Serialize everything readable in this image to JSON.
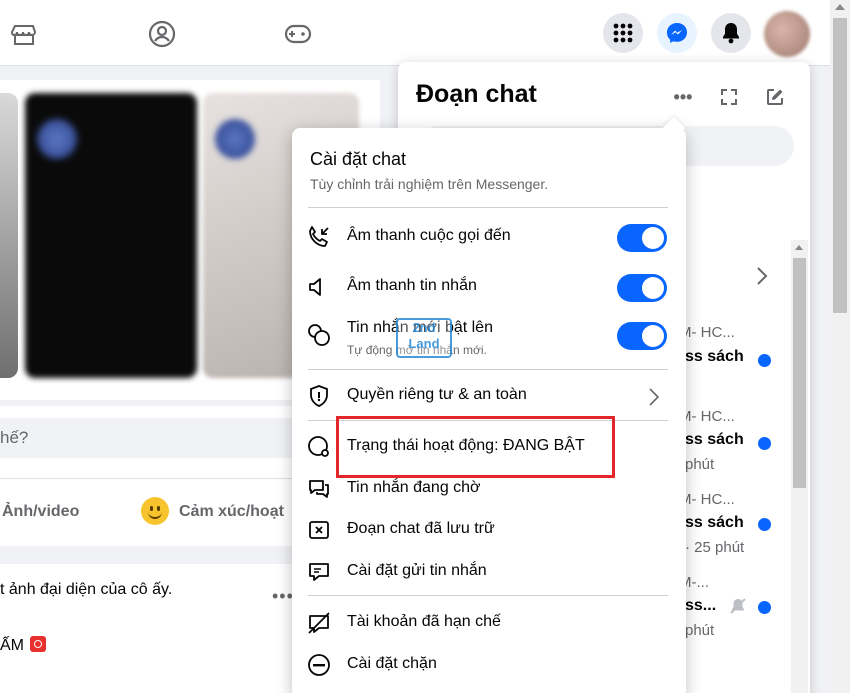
{
  "chat_panel": {
    "title": "Đoạn chat",
    "rows": [
      {
        "line1": "M- HC...",
        "line2": "ss sách",
        "line3": ""
      },
      {
        "line1": "M- HC...",
        "line2": "ss sách",
        "line3": "phút"
      },
      {
        "line1": "M- HC...",
        "line2": "ss sách",
        "line3": "· 25 phút"
      },
      {
        "line1": "M-...",
        "line2": "ss...",
        "line3": "phút"
      }
    ]
  },
  "feed": {
    "composer_placeholder": "hế?",
    "actions": {
      "photo": "Ảnh/video",
      "feeling": "Cảm xúc/hoạt"
    },
    "post_text": "t ảnh đại diện của cô ấy.",
    "post_dots": "•••",
    "post_line2": "ẤM"
  },
  "settings": {
    "title": "Cài đặt chat",
    "subtitle": "Tùy chỉnh trải nghiệm trên Messenger.",
    "toggles": [
      {
        "label": "Âm thanh cuộc gọi đến",
        "on": true
      },
      {
        "label": "Âm thanh tin nhắn",
        "on": true
      },
      {
        "label": "Tin nhắn mới bật lên",
        "sublabel": "Tự động mở tin nhắn mới.",
        "on": true
      }
    ],
    "privacy": "Quyền riêng tư & an toàn",
    "items": [
      {
        "label": "Trạng thái hoạt động: ĐANG BẬT"
      },
      {
        "label": "Tin nhắn đang chờ"
      },
      {
        "label": "Đoạn chat đã lưu trữ"
      },
      {
        "label": "Cài đặt gửi tin nhắn"
      },
      {
        "label": "Tài khoản đã hạn chế"
      },
      {
        "label": "Cài đặt chặn"
      }
    ]
  },
  "watermark": "2nd Land",
  "colors": {
    "accent": "#0866ff",
    "highlight": "#e3262a",
    "secondary_text": "#65676b"
  }
}
